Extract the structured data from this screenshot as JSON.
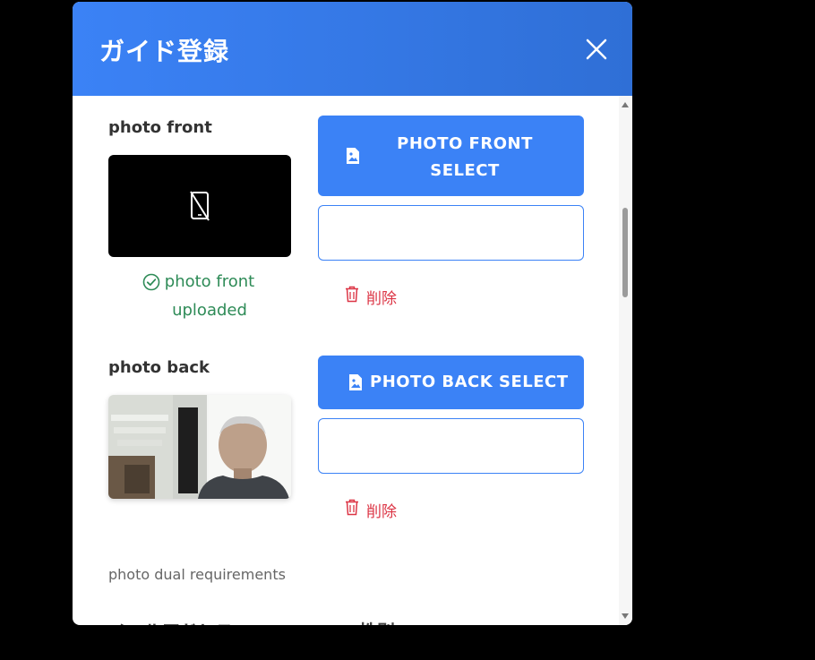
{
  "modal": {
    "title": "ガイド登録"
  },
  "front": {
    "label": "photo front",
    "uploaded_text": "photo front uploaded",
    "select_button": "PHOTO FRONT SELECT",
    "delete_label": "削除"
  },
  "back": {
    "label": "photo back",
    "select_button": "PHOTO BACK SELECT",
    "delete_label": "削除"
  },
  "requirements_text": "photo dual requirements",
  "next_section": {
    "email_label": "メールアドレス",
    "gender_label": "性別"
  },
  "colors": {
    "primary": "#3b82f6",
    "success": "#2e8b57",
    "danger": "#dc3545"
  }
}
